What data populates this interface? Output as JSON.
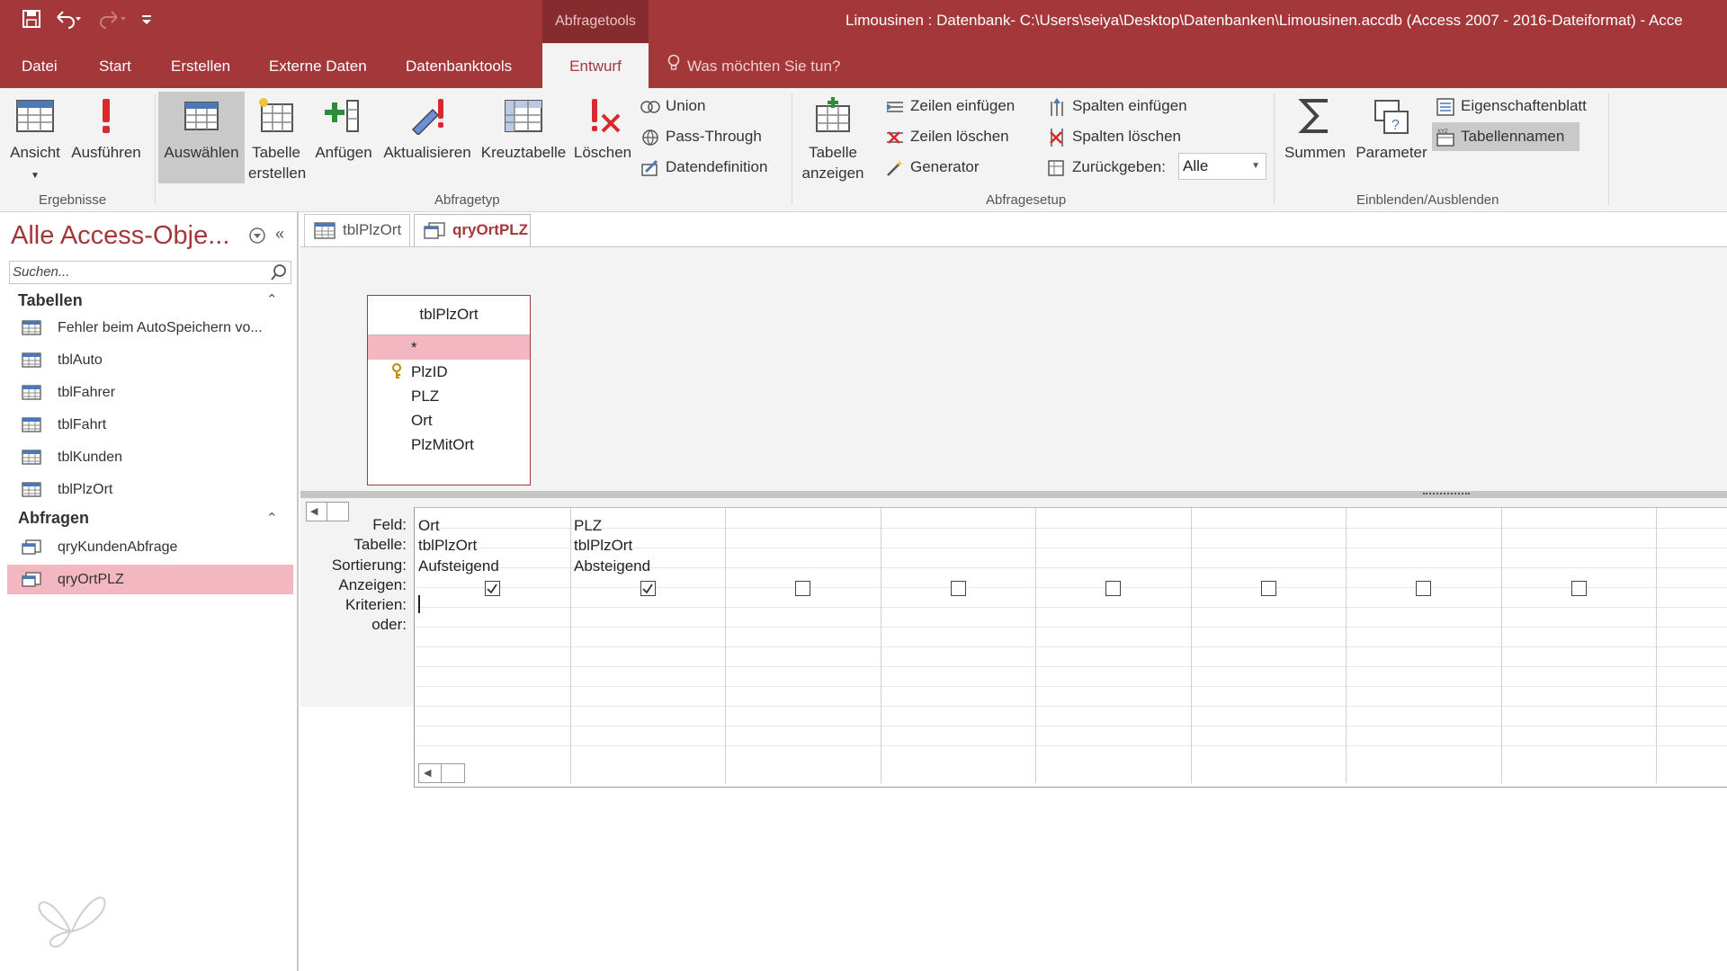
{
  "title_bar": {
    "context_tab": "Abfragetools",
    "window_title": "Limousinen : Datenbank- C:\\Users\\seiya\\Desktop\\Datenbanken\\Limousinen.accdb (Access 2007 - 2016-Dateiformat) - Acce"
  },
  "tabs": [
    "Datei",
    "Start",
    "Erstellen",
    "Externe Daten",
    "Datenbanktools",
    "Entwurf"
  ],
  "active_tab": "Entwurf",
  "tell_me": "Was möchten Sie tun?",
  "ribbon": {
    "ergebnisse": {
      "label": "Ergebnisse",
      "ansicht": "Ansicht",
      "ausfuehren": "Ausführen"
    },
    "abfragetyp": {
      "label": "Abfragetyp",
      "auswaehlen": "Auswählen",
      "tabelle_l1": "Tabelle",
      "tabelle_l2": "erstellen",
      "anfuegen": "Anfügen",
      "aktualisieren": "Aktualisieren",
      "kreuztabelle": "Kreuztabelle",
      "loeschen": "Löschen",
      "union": "Union",
      "passthrough": "Pass-Through",
      "datendefinition": "Datendefinition"
    },
    "abfragesetup": {
      "label": "Abfragesetup",
      "tabelle_anzeigen_l1": "Tabelle",
      "tabelle_anzeigen_l2": "anzeigen",
      "zeilen_einfuegen": "Zeilen einfügen",
      "zeilen_loeschen": "Zeilen löschen",
      "generator": "Generator",
      "spalten_einfuegen": "Spalten einfügen",
      "spalten_loeschen": "Spalten löschen",
      "zurueckgeben": "Zurückgeben:",
      "zurueckgeben_value": "Alle"
    },
    "einblenden": {
      "label": "Einblenden/Ausblenden",
      "summen": "Summen",
      "parameter": "Parameter",
      "eigenschaftenblatt": "Eigenschaftenblatt",
      "tabellennamen": "Tabellennamen"
    }
  },
  "nav": {
    "title": "Alle Access-Obje...",
    "search_placeholder": "Suchen...",
    "tables_header": "Tabellen",
    "tables": [
      "Fehler beim AutoSpeichern vo...",
      "tblAuto",
      "tblFahrer",
      "tblFahrt",
      "tblKunden",
      "tblPlzOrt"
    ],
    "queries_header": "Abfragen",
    "queries": [
      "qryKundenAbfrage",
      "qryOrtPLZ"
    ]
  },
  "doc_tabs": [
    "tblPlzOrt",
    "qryOrtPLZ"
  ],
  "table_box": {
    "name": "tblPlzOrt",
    "fields": [
      "*",
      "PlzID",
      "PLZ",
      "Ort",
      "PlzMitOrt"
    ]
  },
  "grid": {
    "row_labels": [
      "Feld:",
      "Tabelle:",
      "Sortierung:",
      "Anzeigen:",
      "Kriterien:",
      "oder:"
    ],
    "columns": [
      {
        "feld": "Ort",
        "tabelle": "tblPlzOrt",
        "sortierung": "Aufsteigend",
        "anzeigen": true
      },
      {
        "feld": "PLZ",
        "tabelle": "tblPlzOrt",
        "sortierung": "Absteigend",
        "anzeigen": true
      }
    ]
  }
}
